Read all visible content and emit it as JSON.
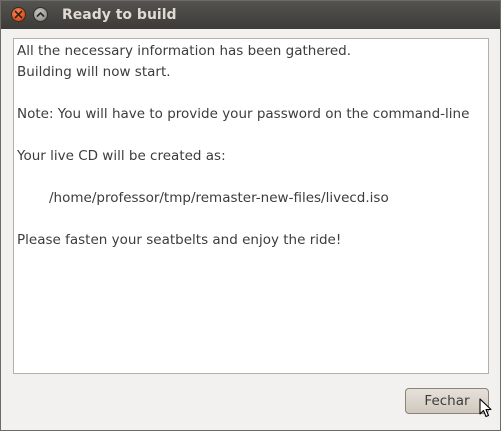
{
  "window": {
    "title": "Ready to build"
  },
  "message": {
    "lines": [
      "All the necessary information has been gathered.",
      "Building will now start.",
      "",
      "Note: You will have to provide your password on the command-line",
      "",
      "Your live CD will be created as:",
      "",
      "/home/professor/tmp/remaster-new-files/livecd.iso",
      "",
      "Please fasten your seatbelts and enjoy the ride!"
    ]
  },
  "buttons": {
    "close_label": "Fechar"
  },
  "icons": {
    "window_close": "close-icon",
    "window_maximize": "maximize-icon",
    "cursor": "mouse-pointer-icon"
  },
  "colors": {
    "titlebar": "#3c3b37",
    "close_button": "#e4571b",
    "background": "#f2f1f0"
  }
}
